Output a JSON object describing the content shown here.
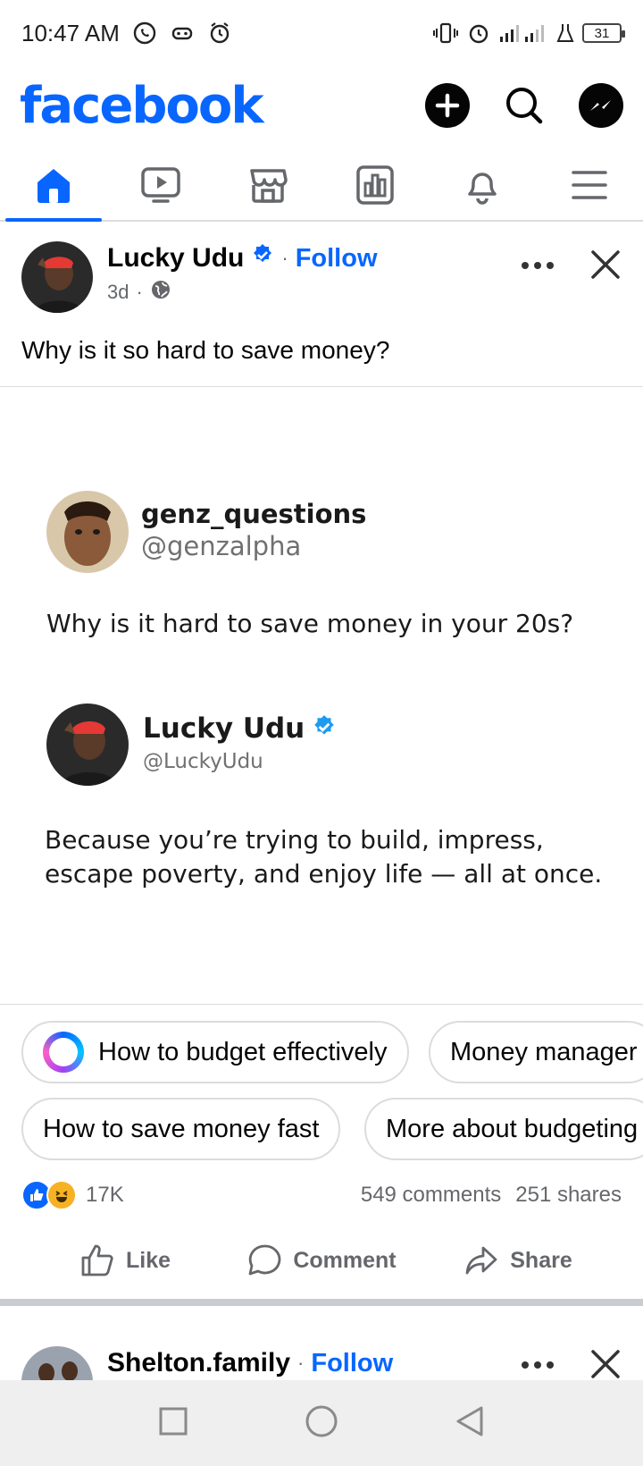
{
  "status_bar": {
    "time": "10:47 AM",
    "battery": "31"
  },
  "header": {
    "logo": "facebook",
    "icons": [
      "plus-icon",
      "search-icon",
      "messenger-icon"
    ]
  },
  "nav_tabs": [
    "home",
    "video",
    "marketplace",
    "dashboard",
    "notifications",
    "menu"
  ],
  "post": {
    "author": "Lucky Udu",
    "follow_label": "Follow",
    "dot": "·",
    "time": "3d",
    "text": "Why is it so hard to save money?",
    "quote": {
      "q_name": "genz_questions",
      "q_handle": "@genzalpha",
      "question": "Why is it hard to save money in your 20s?",
      "a_name": "Lucky Udu",
      "a_handle": "@LuckyUdu",
      "answer_line1": "Because you’re trying to build, impress,",
      "answer_line2": "escape poverty, and enjoy life — all at once."
    },
    "chips": [
      "How to budget effectively",
      "Money manager",
      "How to save money fast",
      "More about budgeting"
    ],
    "reactions_count": "17K",
    "comments": "549 comments",
    "shares": "251 shares",
    "actions": {
      "like": "Like",
      "comment": "Comment",
      "share": "Share"
    }
  },
  "next_post": {
    "author": "Shelton.family",
    "follow_label": "Follow",
    "dot": "·"
  },
  "colors": {
    "brand": "#0866ff",
    "secondary_text": "#65676b"
  }
}
